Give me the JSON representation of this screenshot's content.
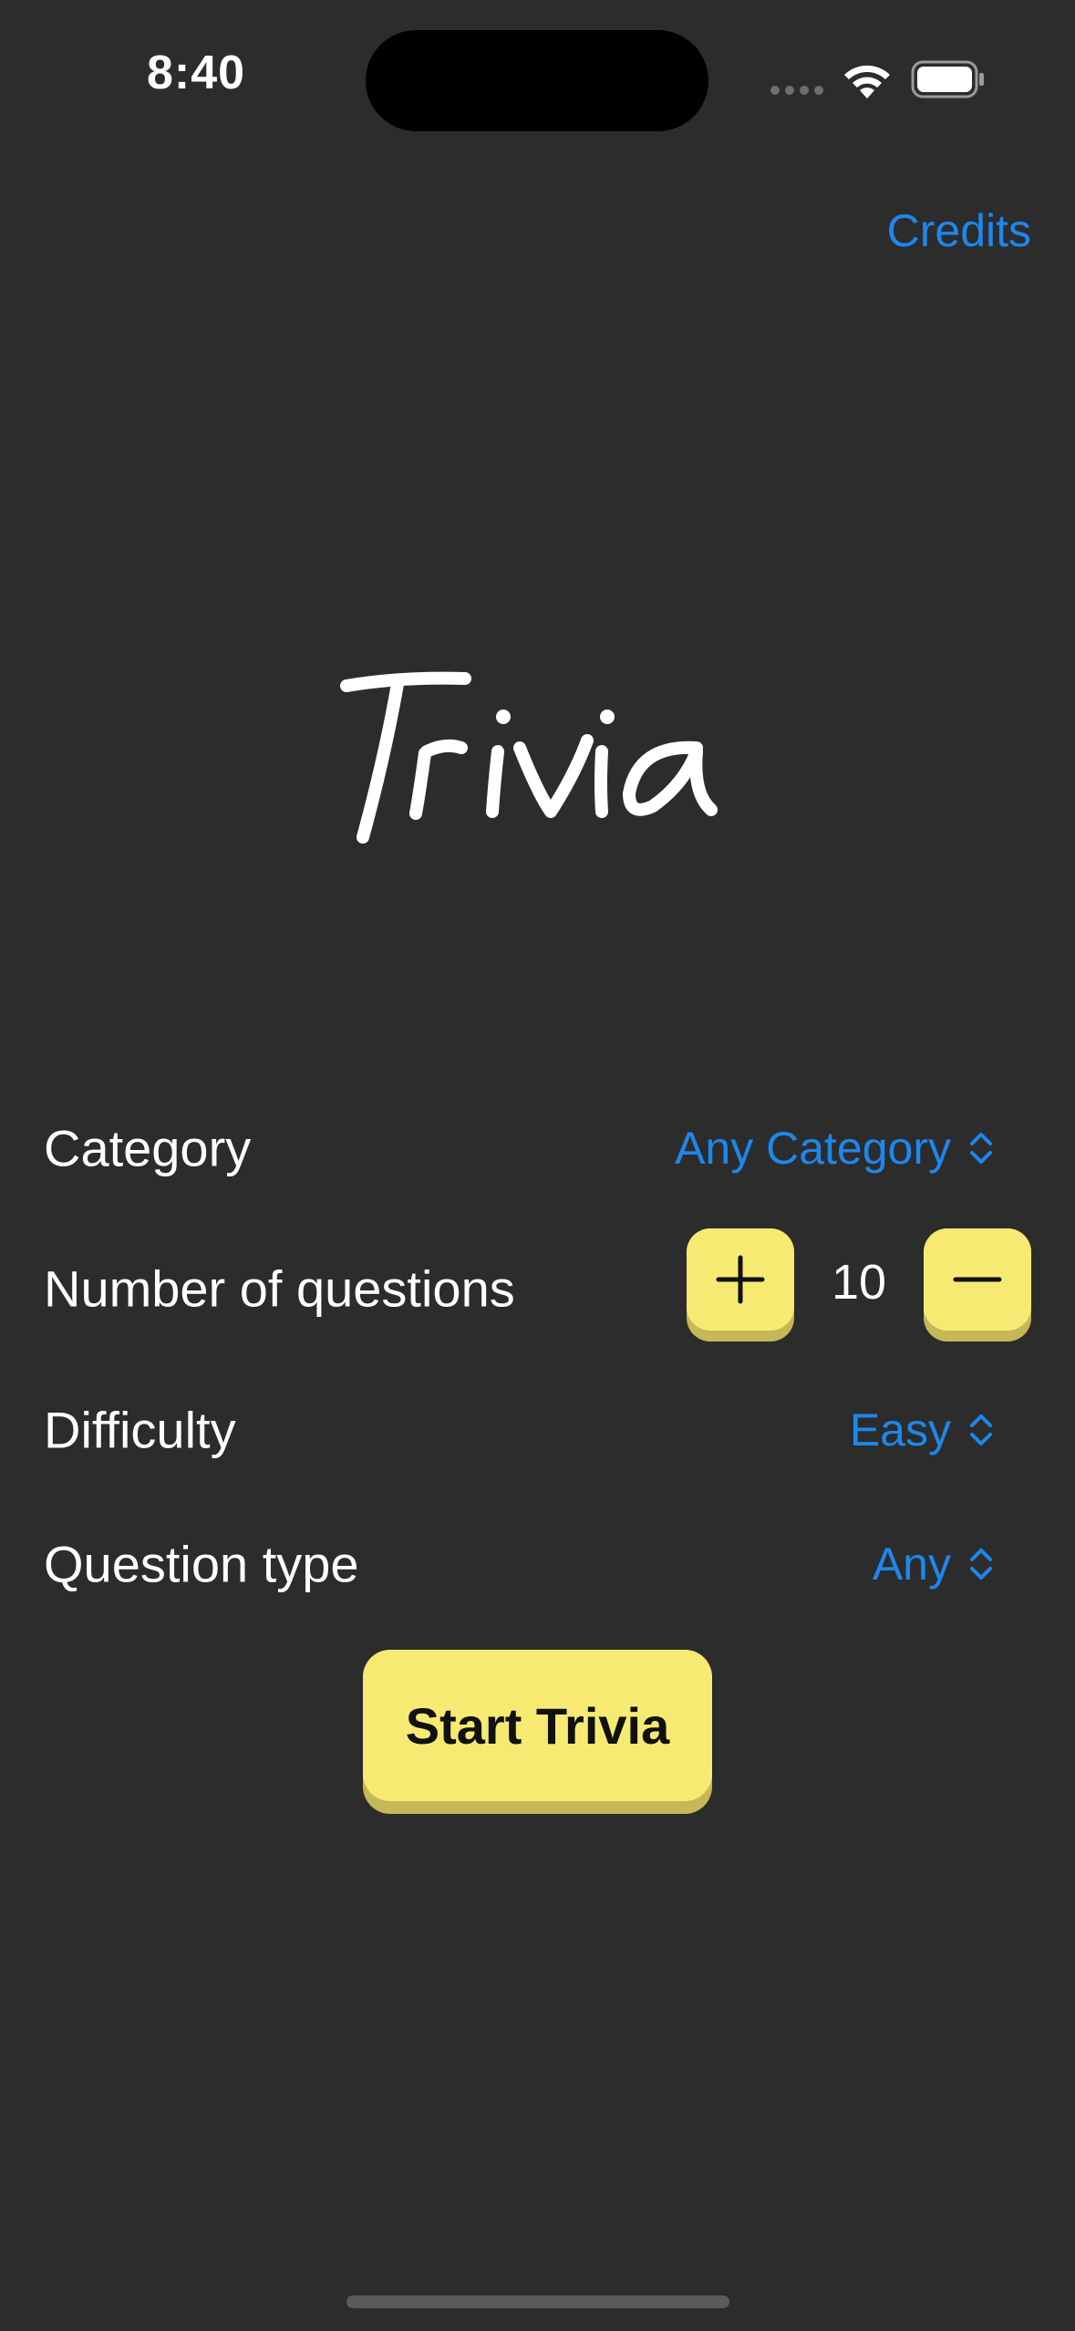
{
  "status_bar": {
    "time": "8:40",
    "wifi_icon": "wifi-icon",
    "battery_icon": "battery-icon"
  },
  "header": {
    "credits_label": "Credits"
  },
  "logo": {
    "text": "Trivia"
  },
  "form": {
    "category": {
      "label": "Category",
      "value": "Any Category"
    },
    "question_count": {
      "label": "Number of questions",
      "value": "10"
    },
    "difficulty": {
      "label": "Difficulty",
      "value": "Easy"
    },
    "question_type": {
      "label": "Question type",
      "value": "Any"
    }
  },
  "start_button": {
    "label": "Start Trivia"
  },
  "colors": {
    "background": "#2c2c2c",
    "accent_blue": "#1d87ec",
    "key_yellow": "#f7ea73",
    "key_shadow": "#c4b857",
    "text": "#ffffff"
  }
}
